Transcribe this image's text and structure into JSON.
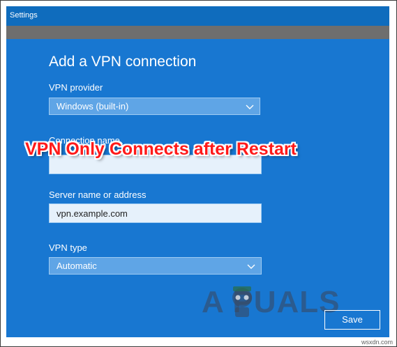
{
  "window": {
    "title": "Settings"
  },
  "form": {
    "heading": "Add a VPN connection",
    "vpn_provider_label": "VPN provider",
    "vpn_provider_value": "Windows (built-in)",
    "connection_name_label": "Connection name",
    "server_label": "Server name or address",
    "server_value": "vpn.example.com",
    "vpn_type_label": "VPN type",
    "vpn_type_value": "Automatic",
    "save_label": "Save"
  },
  "overlay": {
    "title": "VPN Only Connects after Restart"
  },
  "watermark": {
    "brand": "A  PUALS",
    "site": "wsxdn.com"
  },
  "icons": {
    "dropdown": "chevron-down-icon",
    "mascot": "appuals-mascot-icon"
  },
  "colors": {
    "accent": "#1877d1",
    "title_bar": "#0f6cbd",
    "overlay_text": "#ff1a1a"
  }
}
